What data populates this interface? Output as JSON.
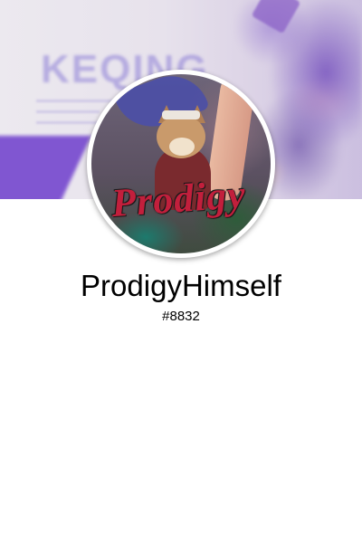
{
  "banner": {
    "text": "KEQING",
    "accent": "#7b4fd0"
  },
  "avatar": {
    "overlay_text": "Prodigy"
  },
  "profile": {
    "username": "ProdigyHimself",
    "discriminator": "#8832"
  }
}
